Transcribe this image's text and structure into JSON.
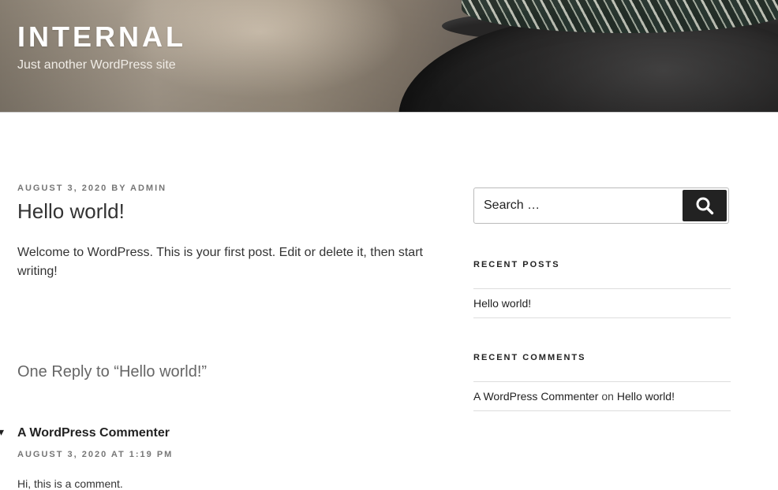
{
  "header": {
    "site_title": "INTERNAL",
    "site_description": "Just another WordPress site"
  },
  "post": {
    "date": "AUGUST 3, 2020",
    "by": "BY",
    "author": "ADMIN",
    "title": "Hello world!",
    "content": "Welcome to WordPress. This is your first post. Edit or delete it, then start writing!"
  },
  "comments": {
    "title": "One Reply to “Hello world!”",
    "items": [
      {
        "author": "A WordPress Commenter",
        "meta": "AUGUST 3, 2020 AT 1:19 PM",
        "text": "Hi, this is a comment."
      }
    ]
  },
  "sidebar": {
    "search": {
      "placeholder": "Search …",
      "button_icon": "search-icon"
    },
    "recent_posts": {
      "title": "RECENT POSTS",
      "items": [
        "Hello world!"
      ]
    },
    "recent_comments": {
      "title": "RECENT COMMENTS",
      "items": [
        {
          "author": "A WordPress Commenter",
          "on": "on",
          "post": "Hello world!"
        }
      ]
    }
  },
  "colors": {
    "text": "#222222",
    "meta": "#767676",
    "button_bg": "#222222",
    "divider": "#dddddd"
  }
}
